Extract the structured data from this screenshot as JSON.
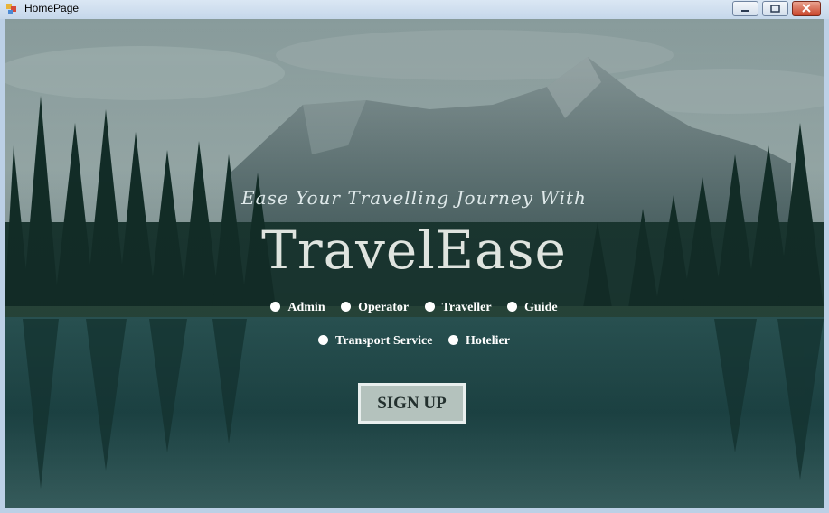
{
  "window": {
    "title": "HomePage"
  },
  "hero": {
    "tagline": "Ease Your Travelling Journey With",
    "brand": "TravelEase"
  },
  "roles": {
    "row1": [
      "Admin",
      "Operator",
      "Traveller",
      "Guide"
    ],
    "row2": [
      "Transport Service",
      "Hotelier"
    ]
  },
  "signup_label": "SIGN UP"
}
